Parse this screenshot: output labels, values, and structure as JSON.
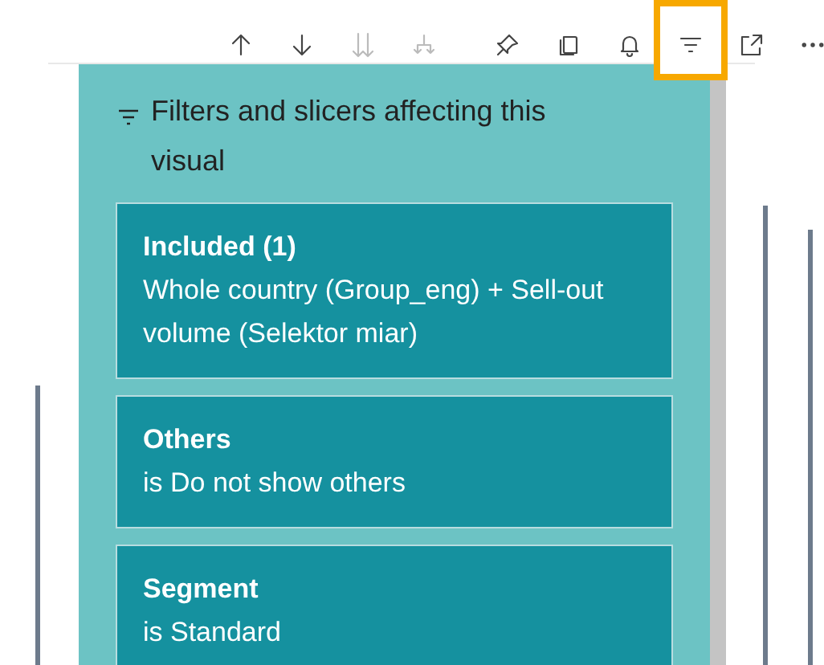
{
  "toolbar": [
    {
      "kind": "arrow-up",
      "disabled": false,
      "selected": false
    },
    {
      "kind": "arrow-down",
      "disabled": false,
      "selected": false
    },
    {
      "kind": "double-down",
      "disabled": true,
      "selected": false
    },
    {
      "kind": "drill",
      "disabled": true,
      "selected": false
    },
    {
      "kind": "pin",
      "disabled": false,
      "selected": false
    },
    {
      "kind": "copy",
      "disabled": false,
      "selected": false
    },
    {
      "kind": "bell",
      "disabled": false,
      "selected": false
    },
    {
      "kind": "filter",
      "disabled": false,
      "selected": true
    },
    {
      "kind": "expand",
      "disabled": false,
      "selected": false
    },
    {
      "kind": "more",
      "disabled": false,
      "selected": false
    }
  ],
  "filter_panel": {
    "title": "Filters and slicers affecting this visual",
    "cards": [
      {
        "title": "Included (1)",
        "description": "Whole country (Group_eng) + Sell-out volume (Selektor miar)"
      },
      {
        "title": "Others",
        "description": "is Do not show others"
      },
      {
        "title": "Segment",
        "description": "is Standard"
      }
    ]
  }
}
